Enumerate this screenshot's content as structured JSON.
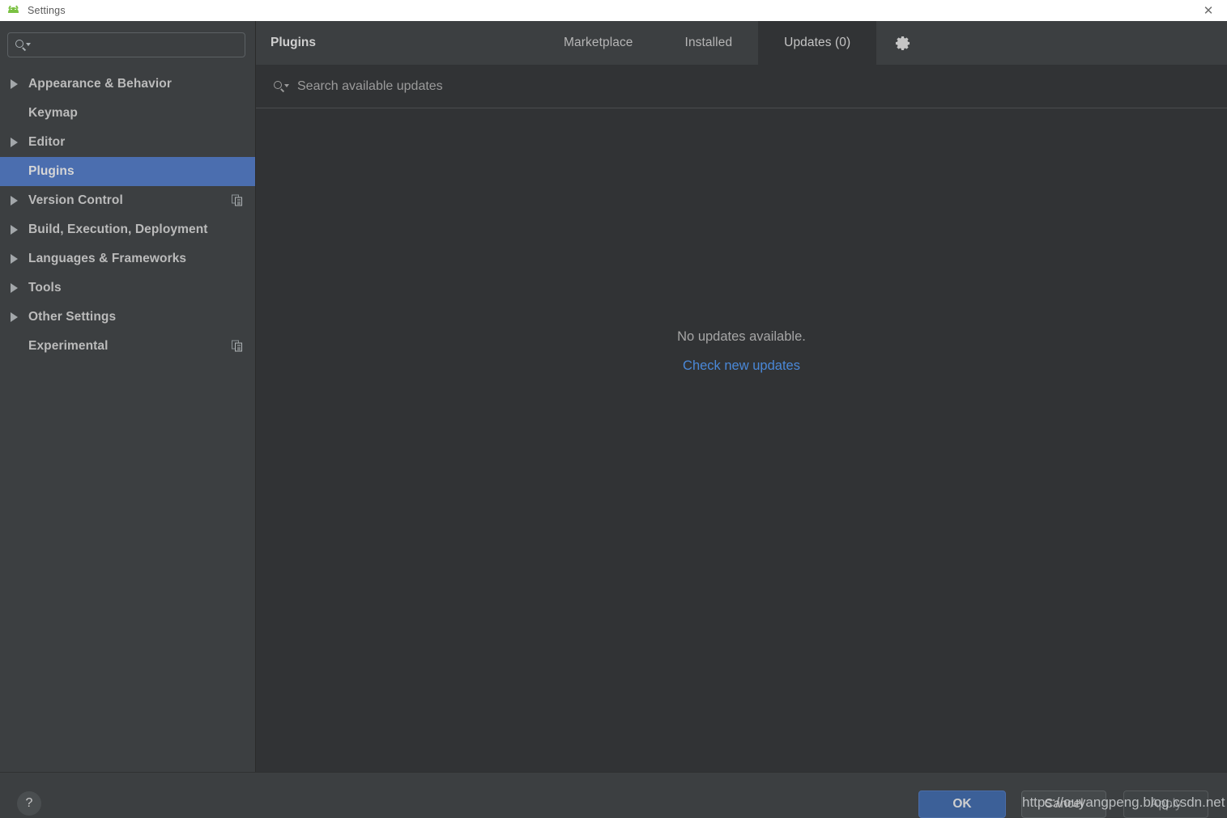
{
  "window": {
    "title": "Settings",
    "app_icon": "android-icon",
    "close_label": "✕"
  },
  "sidebar": {
    "search": {
      "value": "",
      "placeholder": "",
      "icon": "search-icon"
    },
    "items": [
      {
        "label": "Appearance & Behavior",
        "expandable": true,
        "selected": false,
        "trailing_icon": ""
      },
      {
        "label": "Keymap",
        "expandable": false,
        "selected": false,
        "trailing_icon": ""
      },
      {
        "label": "Editor",
        "expandable": true,
        "selected": false,
        "trailing_icon": ""
      },
      {
        "label": "Plugins",
        "expandable": false,
        "selected": true,
        "trailing_icon": ""
      },
      {
        "label": "Version Control",
        "expandable": true,
        "selected": false,
        "trailing_icon": "copy-icon"
      },
      {
        "label": "Build, Execution, Deployment",
        "expandable": true,
        "selected": false,
        "trailing_icon": ""
      },
      {
        "label": "Languages & Frameworks",
        "expandable": true,
        "selected": false,
        "trailing_icon": ""
      },
      {
        "label": "Tools",
        "expandable": true,
        "selected": false,
        "trailing_icon": ""
      },
      {
        "label": "Other Settings",
        "expandable": true,
        "selected": false,
        "trailing_icon": ""
      },
      {
        "label": "Experimental",
        "expandable": false,
        "selected": false,
        "trailing_icon": "copy-icon"
      }
    ]
  },
  "main": {
    "panel_title": "Plugins",
    "tabs": [
      {
        "label": "Marketplace",
        "active": false
      },
      {
        "label": "Installed",
        "active": false
      },
      {
        "label": "Updates (0)",
        "active": true
      }
    ],
    "gear_icon": "gear-icon",
    "search": {
      "value": "",
      "placeholder": "Search available updates",
      "icon": "search-icon"
    },
    "empty_state": {
      "message": "No updates available.",
      "link": "Check new updates"
    }
  },
  "footer": {
    "help_label": "?",
    "ok_label": "OK",
    "cancel_label": "Cancel",
    "apply_label": "Apply"
  },
  "watermark": {
    "text": "https://ouyangpeng.blog.csdn.net"
  },
  "colors": {
    "sidebar_bg": "#3c3f41",
    "content_bg": "#313335",
    "selection_blue": "#4b6eaf",
    "link_blue": "#4a88d8",
    "ok_button": "#3c6098",
    "titlebar_bg": "#ffffff",
    "android_green": "#7bc143"
  }
}
